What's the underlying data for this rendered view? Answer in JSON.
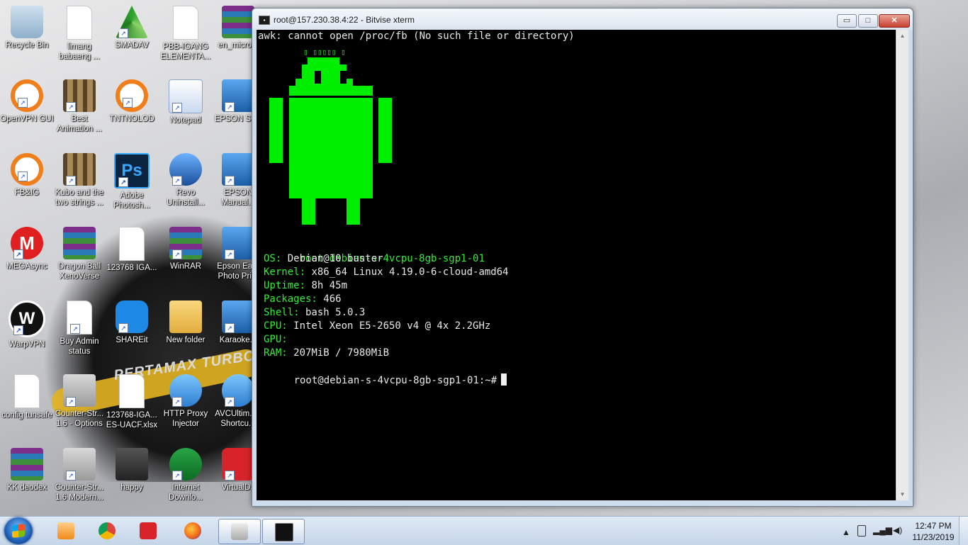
{
  "desktop": {
    "icons": [
      {
        "label": "Recycle Bin",
        "icon": "recycle-bin-icon"
      },
      {
        "label": "limang babaeng ...",
        "icon": "document-icon"
      },
      {
        "label": "SMADAV",
        "icon": "smadav-icon"
      },
      {
        "label": "PBB-IGANG ELEMENTA...",
        "icon": "document-icon"
      },
      {
        "label": "en_micro...",
        "icon": "winrar-icon"
      },
      {
        "label": "OpenVPN GUI",
        "icon": "openvpn-icon"
      },
      {
        "label": "Best Animation ...",
        "icon": "video-icon"
      },
      {
        "label": "TNTNOLOD",
        "icon": "openvpn-icon"
      },
      {
        "label": "Notepad",
        "icon": "notepad-icon"
      },
      {
        "label": "EPSON Sc...",
        "icon": "scanner-icon"
      },
      {
        "label": "FB&IG",
        "icon": "openvpn-icon"
      },
      {
        "label": "Kubo and the two strings ...",
        "icon": "video-icon"
      },
      {
        "label": "Adobe Photosh...",
        "icon": "photoshop-icon"
      },
      {
        "label": "Revo Uninstall...",
        "icon": "revo-icon"
      },
      {
        "label": "EPSON Manual...",
        "icon": "epson-manual-icon"
      },
      {
        "label": "MEGAsync",
        "icon": "mega-icon"
      },
      {
        "label": "Dragon Ball XenoVerse",
        "icon": "winrar-icon"
      },
      {
        "label": "123768 IGA...",
        "icon": "document-icon"
      },
      {
        "label": "WinRAR",
        "icon": "winrar-icon"
      },
      {
        "label": "Epson Ea... Photo Pri...",
        "icon": "photo-icon"
      },
      {
        "label": "WarpVPN",
        "icon": "warpvpn-icon"
      },
      {
        "label": "Buy Admin status",
        "icon": "document-icon"
      },
      {
        "label": "SHAREit",
        "icon": "shareit-icon"
      },
      {
        "label": "New folder",
        "icon": "folder-icon"
      },
      {
        "label": "Karaoke...",
        "icon": "karaoke-icon"
      },
      {
        "label": "config tunsafe",
        "icon": "text-file-icon"
      },
      {
        "label": "Counter-Str... 1.6 - Options",
        "icon": "counter-strike-icon"
      },
      {
        "label": "123768-IGA... ES-UACF.xlsx",
        "icon": "document-icon"
      },
      {
        "label": "HTTP Proxy Injector",
        "icon": "proxy-injector-icon"
      },
      {
        "label": "AVCUltim... - Shortcu...",
        "icon": "avc-icon"
      },
      {
        "label": "KK deodex",
        "icon": "winrar-icon"
      },
      {
        "label": "Counter-Str... 1.6 Modern...",
        "icon": "counter-strike-icon"
      },
      {
        "label": "happy",
        "icon": "image-icon"
      },
      {
        "label": "Internet Downlo...",
        "icon": "idm-icon"
      },
      {
        "label": "VirtualDJ",
        "icon": "virtualdj-icon"
      }
    ],
    "wallpaper_text": "PERTAMAX TURBO"
  },
  "window": {
    "title": "root@157.230.38.4:22 - Bitvise xterm",
    "controls": {
      "minimize": "▭",
      "maximize": "□",
      "close": "✕"
    }
  },
  "terminal": {
    "error_line": "awk: cannot open /proc/fb (No such file or directory)",
    "android_caption": "▯ ▯▯▯▯▯ ▯",
    "host_user": "root",
    "host_at": "@",
    "host_name": "debian-s-4vcpu-8gb-sgp1-01",
    "info": [
      {
        "key": "OS:",
        "value": " Debian 10 buster"
      },
      {
        "key": "Kernel:",
        "value": " x86_64 Linux 4.19.0-6-cloud-amd64"
      },
      {
        "key": "Uptime:",
        "value": " 8h 45m"
      },
      {
        "key": "Packages:",
        "value": " 466"
      },
      {
        "key": "Shell:",
        "value": " bash 5.0.3"
      },
      {
        "key": "CPU:",
        "value": " Intel Xeon E5-2650 v4 @ 4x 2.2GHz"
      },
      {
        "key": "GPU:",
        "value": ""
      },
      {
        "key": "RAM:",
        "value": " 207MiB / 7980MiB"
      }
    ],
    "prompt": "root@debian-s-4vcpu-8gb-sgp1-01:~#"
  },
  "taskbar": {
    "pinned": [
      "media-player-icon",
      "chrome-icon",
      "virtualdj-icon",
      "firefox-icon",
      "satellite-icon",
      "bitvise-xterm-icon"
    ],
    "tray": {
      "time": "12:47 PM",
      "date": "11/23/2019",
      "expand": "▲"
    }
  },
  "colors": {
    "terminal_bg": "#000000",
    "terminal_green": "#33ee33",
    "android_green": "#00ee00"
  }
}
